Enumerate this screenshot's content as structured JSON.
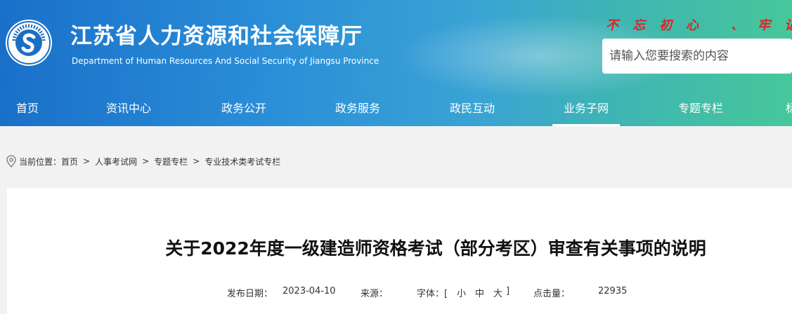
{
  "header": {
    "title": "江苏省人力资源和社会保障厅",
    "subtitle": "Department of Human Resources And Social Security of Jiangsu Province",
    "slogan": "不忘初心 、牢记",
    "search_placeholder": "请输入您要搜索的内容",
    "logo_icon": "jiangsu-hrss-logo-icon"
  },
  "nav": {
    "items": [
      {
        "label": "首页"
      },
      {
        "label": "资讯中心"
      },
      {
        "label": "政务公开"
      },
      {
        "label": "政务服务"
      },
      {
        "label": "政民互动"
      },
      {
        "label": "业务子网"
      },
      {
        "label": "专题专栏"
      },
      {
        "label": "标"
      }
    ],
    "active": "业务子网"
  },
  "breadcrumb": {
    "icon": "location-pin-icon",
    "prefix": "当前位置：",
    "items": [
      "首页",
      "人事考试网",
      "专题专栏",
      "专业技术类考试专栏"
    ],
    "separator": ">"
  },
  "article": {
    "title": "关于2022年度一级建造师资格考试（部分考区）审查有关事项的说明",
    "publish_label": "发布日期：",
    "publish_date": "2023-04-10",
    "source_label": "来源：",
    "font_label": "字体：[",
    "font_small": "小",
    "font_medium": "中",
    "font_large": "大",
    "font_close": "]",
    "views_label": "点击量：",
    "views": "22935"
  },
  "colors": {
    "header_start": "#1a70c9",
    "header_end": "#47c79a",
    "slogan": "#d9252a"
  }
}
